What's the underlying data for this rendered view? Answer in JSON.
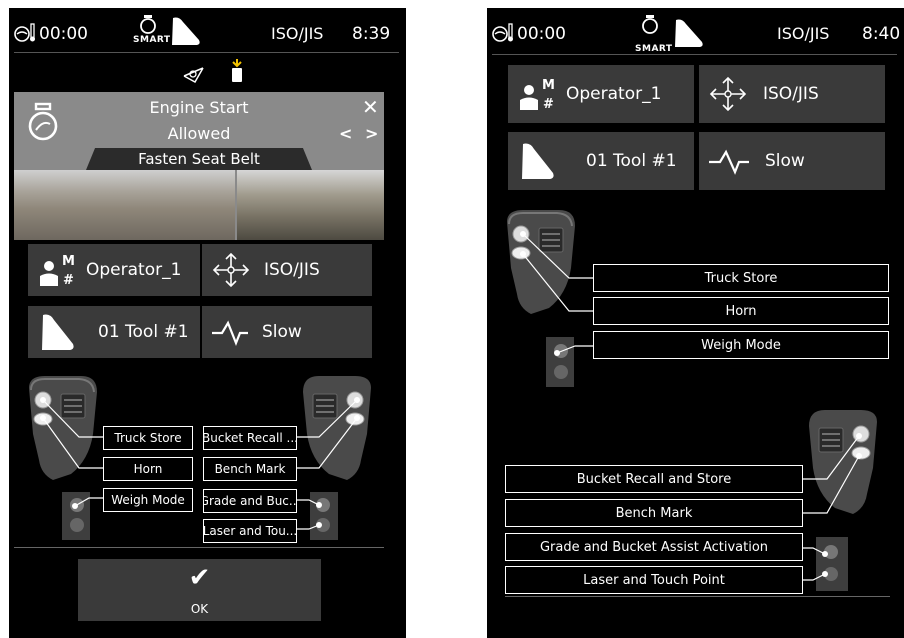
{
  "left": {
    "status": {
      "time_label": "00:00",
      "smart_label": "SMART",
      "mode": "ISO/JIS",
      "clock": "8:39"
    },
    "notice": {
      "title": "Engine Start",
      "subtitle": "Allowed",
      "banner": "Fasten Seat Belt",
      "close_glyph": "✕",
      "prev_glyph": "<",
      "next_glyph": ">"
    },
    "tiles": {
      "operator": "Operator_1",
      "pattern": "ISO/JIS",
      "tool": "01  Tool #1",
      "speed": "Slow"
    },
    "callouts": {
      "truck_store": "Truck Store",
      "horn": "Horn",
      "weigh_mode": "Weigh Mode",
      "bucket_recall": "Bucket Recall ...",
      "bench_mark": "Bench Mark",
      "grade_bucket": "Grade and Buc...",
      "laser_touch": "Laser and Tou..."
    },
    "ok": {
      "glyph": "✔",
      "label": "OK"
    }
  },
  "right": {
    "status": {
      "time_label": "00:00",
      "smart_label": "SMART",
      "mode": "ISO/JIS",
      "clock": "8:40"
    },
    "tiles": {
      "operator": "Operator_1",
      "pattern": "ISO/JIS",
      "tool": "01  Tool #1",
      "speed": "Slow"
    },
    "callouts": {
      "truck_store": "Truck Store",
      "horn": "Horn",
      "weigh_mode": "Weigh Mode",
      "bucket_recall": "Bucket Recall and Store",
      "bench_mark": "Bench Mark",
      "grade_bucket": "Grade and Bucket Assist Activation",
      "laser_touch": "Laser and Touch Point"
    }
  },
  "icons": {
    "status_gauge": "engine-temp-icon",
    "status_engine": "engine-icon",
    "status_bucket": "bucket-icon",
    "operator": "operator-icon",
    "pattern": "pattern-arrows-icon",
    "tool": "bucket-tool-icon",
    "speed": "speed-wave-icon",
    "notice_engine": "engine-outline-icon"
  },
  "colors": {
    "background": "#000000",
    "tile": "#3a3a3a",
    "notice": "#8a8a8a",
    "text": "#ffffff"
  }
}
